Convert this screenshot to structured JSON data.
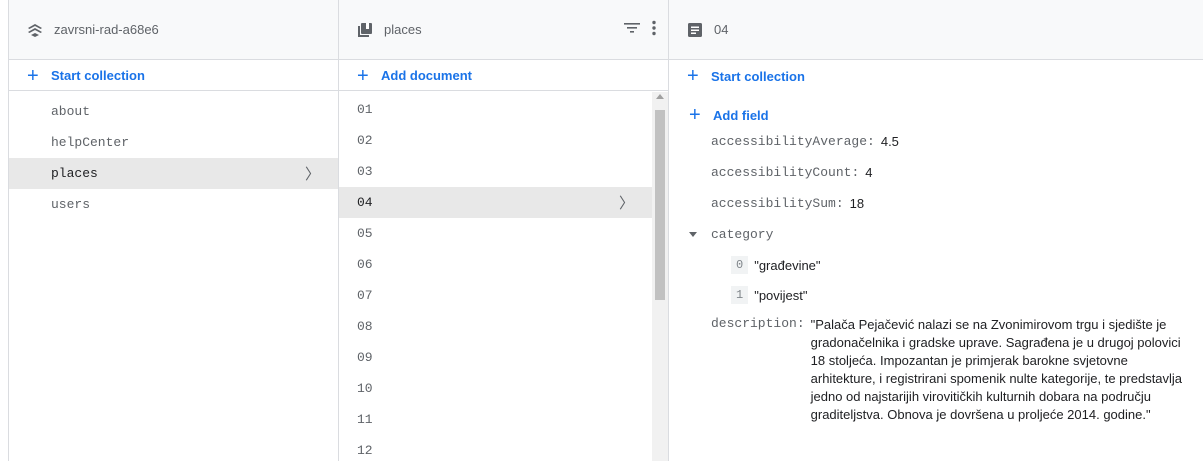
{
  "col1": {
    "header_title": "zavrsni-rad-a68e6",
    "action_label": "Start collection",
    "items": [
      "about",
      "helpCenter",
      "places",
      "users"
    ]
  },
  "col2": {
    "header_title": "places",
    "action_label": "Add document",
    "items": [
      "01",
      "02",
      "03",
      "04",
      "05",
      "06",
      "07",
      "08",
      "09",
      "10",
      "11",
      "12"
    ]
  },
  "col3": {
    "header_title": "04",
    "action_label": "Start collection",
    "add_field_label": "Add field",
    "fields": {
      "accessibilityAverage": {
        "key": "accessibilityAverage",
        "value": "4.5"
      },
      "accessibilityCount": {
        "key": "accessibilityCount",
        "value": "4"
      },
      "accessibilitySum": {
        "key": "accessibilitySum",
        "value": "18"
      },
      "category": {
        "key": "category",
        "items": [
          {
            "index": "0",
            "value": "\"građevine\""
          },
          {
            "index": "1",
            "value": "\"povijest\""
          }
        ]
      },
      "description": {
        "key": "description",
        "value": "\"Palača Pejačević nalazi se na Zvonimirovom trgu i sjedište je gradonačelnika i gradske uprave. Sagrađena je u drugoj polovici 18 stoljeća. Impozantan je primjerak barokne svjetovne arhitekture, i registrirani spomenik nulte kategorije, te predstavlja jedno od najstarijih virovitičkih kulturnih dobara na području graditeljstva. Obnova je dovršena u proljeće 2014. godine.\""
      }
    }
  },
  "colors": {
    "accent": "#1a73e8",
    "selected": "#e8e8e8",
    "border": "#dadce0"
  }
}
